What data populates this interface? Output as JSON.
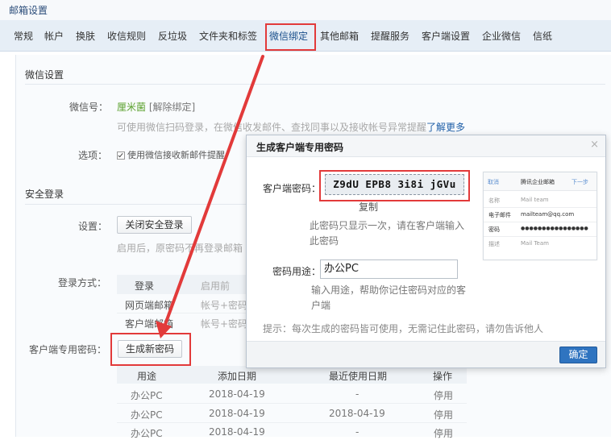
{
  "header": {
    "title": "邮箱设置"
  },
  "tabs": [
    {
      "label": "常规"
    },
    {
      "label": "帐户"
    },
    {
      "label": "换肤"
    },
    {
      "label": "收信规则"
    },
    {
      "label": "反垃圾"
    },
    {
      "label": "文件夹和标签"
    },
    {
      "label": "微信绑定"
    },
    {
      "label": "其他邮箱"
    },
    {
      "label": "提醒服务"
    },
    {
      "label": "客户端设置"
    },
    {
      "label": "企业微信"
    },
    {
      "label": "信纸"
    }
  ],
  "wechat": {
    "section_title": "微信设置",
    "wechat_label": "微信号：",
    "wechat_name": "厘米菌",
    "unbind_link": "[解除绑定]",
    "hint": "可使用微信扫码登录，在微信收发邮件、查找同事以及接收帐号异常提醒",
    "learn_more": "了解更多",
    "option_label": "选项：",
    "option_text": "使用微信接收新邮件提醒"
  },
  "security": {
    "section_title": "安全登录",
    "setting_label": "设置：",
    "close_button": "关闭安全登录",
    "hint": "启用后，原密码不再登录邮箱",
    "method_label": "登录方式：",
    "method_headers": [
      "登录",
      "启用前"
    ],
    "method_rows": [
      {
        "login": "网页端邮箱",
        "before": "帐号+密码"
      },
      {
        "login": "客户端邮箱",
        "before": "帐号+密码"
      }
    ],
    "client_pwd_label": "客户端专用密码：",
    "generate_button": "生成新密码"
  },
  "password_table": {
    "headers": [
      "用途",
      "添加日期",
      "最近使用日期",
      "操作"
    ],
    "rows": [
      {
        "use": "办公PC",
        "added": "2018-04-19",
        "last_used": "-",
        "action": "停用"
      },
      {
        "use": "办公PC",
        "added": "2018-04-19",
        "last_used": "2018-04-19",
        "action": "停用"
      },
      {
        "use": "办公PC",
        "added": "2018-04-19",
        "last_used": "-",
        "action": "停用"
      }
    ]
  },
  "modal": {
    "title": "生成客户端专用密码",
    "close": "×",
    "pwd_label": "客户端密码：",
    "password": "Z9dU EPB8 3i8i jGVu",
    "copy": "复制",
    "pwd_note_line1": "此密码只显示一次，请在客户端输入",
    "pwd_note_line2": "此密码",
    "use_label": "密码用途：",
    "use_value": "办公PC",
    "use_note_line1": "输入用途，帮助你记住密码对应的客",
    "use_note_line2": "户端",
    "tip": "提示：每次生成的密码皆可使用，无需记住此密码，请勿告诉他人",
    "confirm": "确定",
    "preview": {
      "cancel": "取消",
      "title": "腾讯企业邮箱",
      "next": "下一步",
      "rows": [
        {
          "label": "名称",
          "value": "Mail team"
        },
        {
          "label": "电子邮件",
          "value": "mailteam@qq.com"
        },
        {
          "label": "密码",
          "value": "●●●●●●●●●●●●●●●●"
        },
        {
          "label": "描述",
          "value": "Mail Team"
        }
      ]
    }
  },
  "colors": {
    "accent": "#2f74c0",
    "highlight": "#e23a3a",
    "wechat_green": "#5aa02c"
  }
}
